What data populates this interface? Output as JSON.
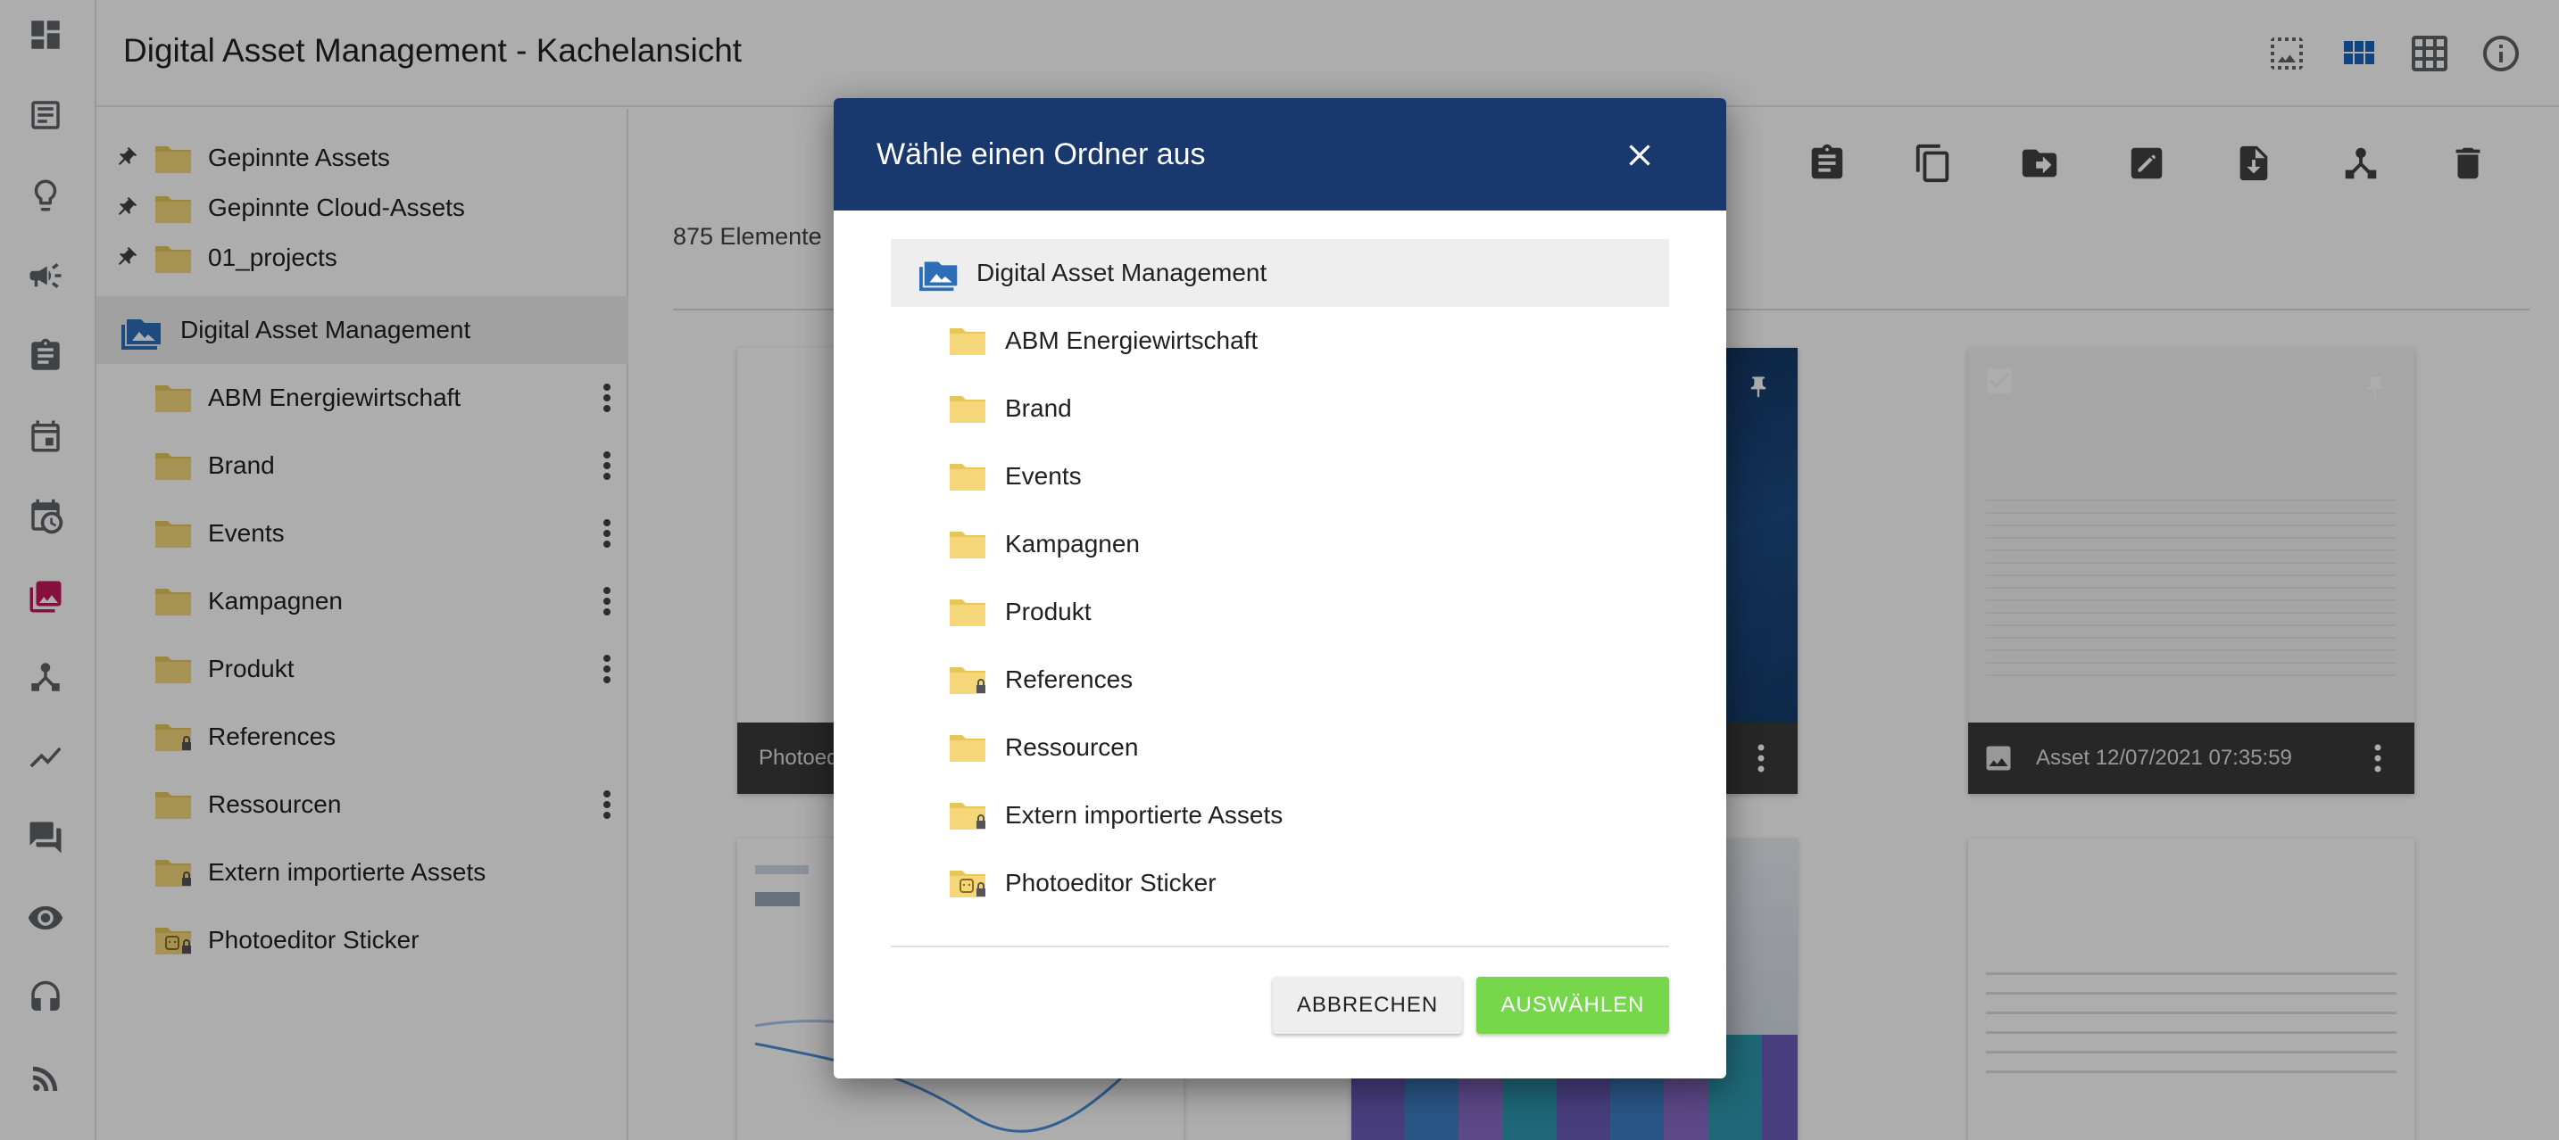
{
  "app": {
    "title": "Digital Asset Management - Kachelansicht"
  },
  "rail": {
    "icons": [
      "dashboard-icon",
      "checklist-icon",
      "lightbulb-icon",
      "megaphone-icon",
      "clipboard-icon",
      "calendar-icon",
      "calendar-clock-icon",
      "media-library-icon",
      "hierarchy-icon",
      "analytics-icon",
      "chat-icon",
      "eye-icon",
      "headset-icon",
      "rss-icon"
    ],
    "active": "media-library-icon",
    "active_color": "#c2185b"
  },
  "header_icons": [
    "image-select-icon",
    "tile-view-icon",
    "table-view-icon",
    "info-icon"
  ],
  "tree": {
    "pinned": [
      {
        "label": "Gepinnte Assets"
      },
      {
        "label": "Gepinnte Cloud-Assets"
      },
      {
        "label": "01_projects"
      }
    ],
    "root": {
      "label": "Digital Asset Management"
    },
    "children": [
      {
        "label": "ABM Energiewirtschaft",
        "locked": false,
        "menu": true
      },
      {
        "label": "Brand",
        "locked": false,
        "menu": true
      },
      {
        "label": "Events",
        "locked": false,
        "menu": true
      },
      {
        "label": "Kampagnen",
        "locked": false,
        "menu": true
      },
      {
        "label": "Produkt",
        "locked": false,
        "menu": true
      },
      {
        "label": "References",
        "locked": true,
        "menu": false
      },
      {
        "label": "Ressourcen",
        "locked": false,
        "menu": true
      },
      {
        "label": "Extern importierte Assets",
        "locked": true,
        "menu": false
      },
      {
        "label": "Photoeditor Sticker",
        "locked": true,
        "menu": false,
        "sticker": true
      }
    ]
  },
  "main": {
    "count_label": "875 Elemente",
    "toolbar_icons": [
      "clipboard-icon",
      "copy-icon",
      "move-folder-icon",
      "edit-icon",
      "download-icon",
      "hierarchy-icon",
      "delete-icon"
    ],
    "tiles": [
      {
        "footer_label": "Photoed"
      },
      {
        "footer_label": ""
      },
      {
        "footer_label": "Asset 12/07/2021 07:35:59"
      }
    ]
  },
  "dialog": {
    "title": "Wähle einen Ordner aus",
    "root": {
      "label": "Digital Asset Management"
    },
    "folders": [
      {
        "label": "ABM Energiewirtschaft",
        "locked": false
      },
      {
        "label": "Brand",
        "locked": false
      },
      {
        "label": "Events",
        "locked": false
      },
      {
        "label": "Kampagnen",
        "locked": false
      },
      {
        "label": "Produkt",
        "locked": false
      },
      {
        "label": "References",
        "locked": true
      },
      {
        "label": "Ressourcen",
        "locked": false
      },
      {
        "label": "Extern importierte Assets",
        "locked": true
      },
      {
        "label": "Photoeditor Sticker",
        "locked": true,
        "sticker": true
      }
    ],
    "cancel_label": "ABBRECHEN",
    "select_label": "AUSWÄHLEN",
    "header_color": "#19386e",
    "select_color": "#76d74a"
  },
  "colors": {
    "folder": "#f5d77a",
    "folder_dark": "#e8c65c",
    "accent_blue": "#1565c0"
  }
}
